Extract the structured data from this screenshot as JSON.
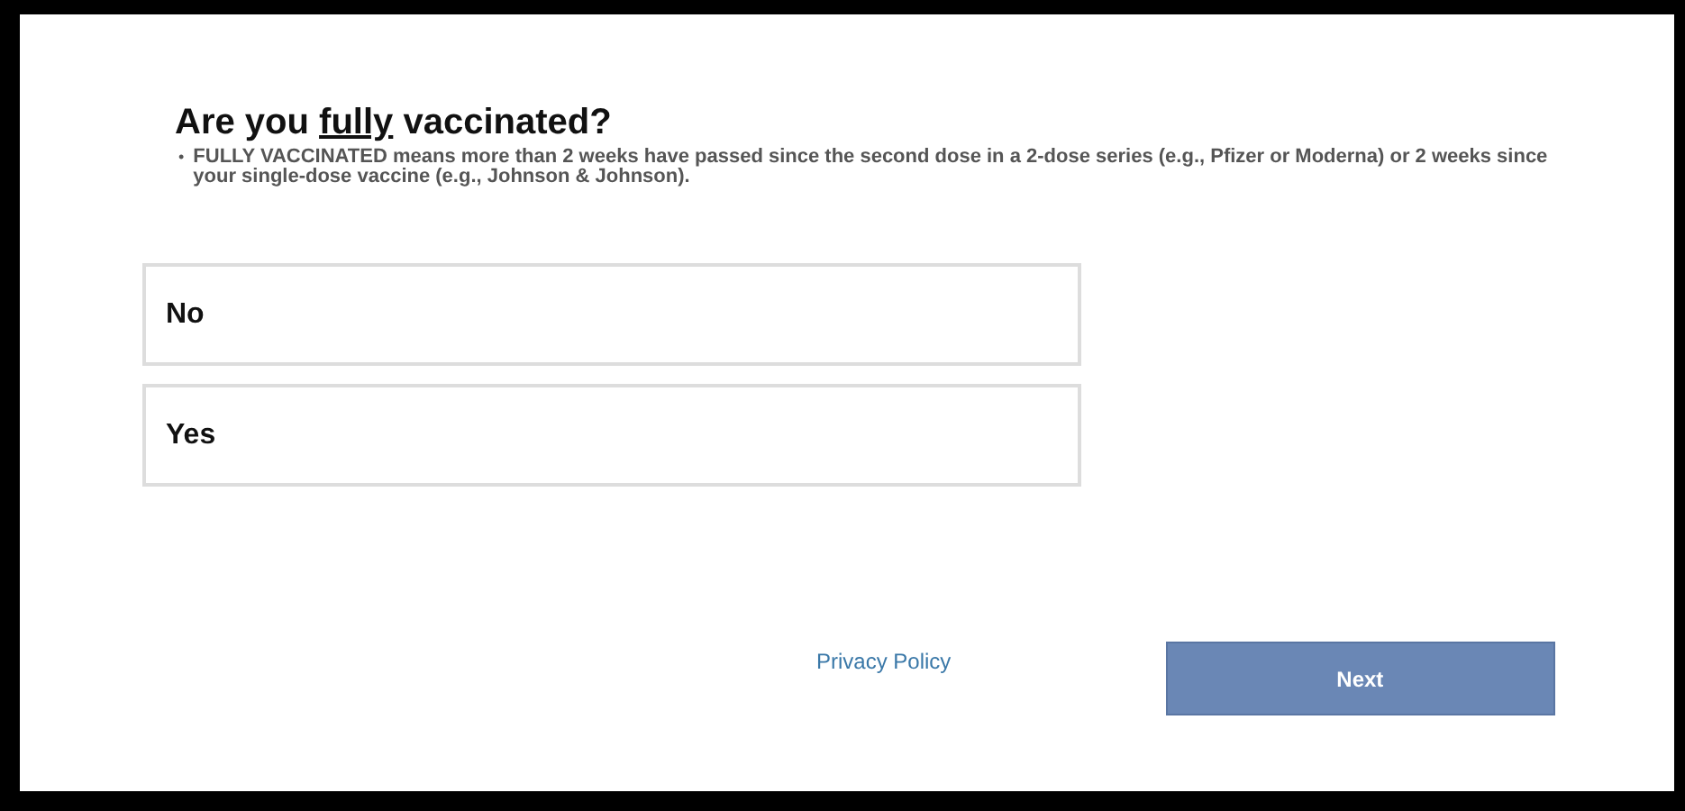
{
  "question": {
    "title_parts": [
      {
        "text": "Are you ",
        "underline": false
      },
      {
        "text": "fully",
        "underline": true
      },
      {
        "text": " vaccinated?",
        "underline": false
      }
    ],
    "bullet": "•",
    "note": "**FULLY VACCINATED** means more than 2 weeks have passed since the second dose in a 2-dose series (e.g., Pfizer or Moderna) or 2 weeks since your single-dose vaccine (e.g., Johnson & Johnson)."
  },
  "options": [
    {
      "label": "No",
      "selected": false
    },
    {
      "label": "Yes",
      "selected": false
    }
  ],
  "footer": {
    "link": "Privacy Policy",
    "button": "Next"
  }
}
